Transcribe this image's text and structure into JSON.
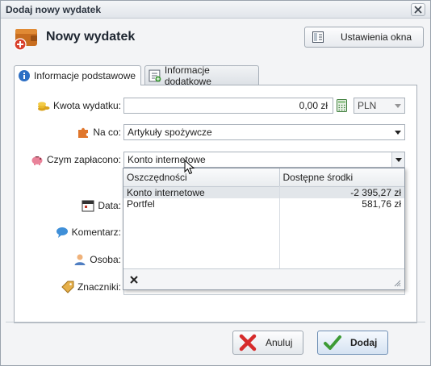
{
  "window": {
    "title": "Dodaj nowy wydatek"
  },
  "header": {
    "title": "Nowy wydatek",
    "settings_label": "Ustawienia okna"
  },
  "tabs": [
    {
      "label": "Informacje podstawowe",
      "active": true
    },
    {
      "label": "Informacje dodatkowe",
      "active": false
    }
  ],
  "form": {
    "amount_label": "Kwota wydatku:",
    "amount_value": "0,00 zł",
    "currency": "PLN",
    "category_label": "Na co:",
    "category_value": "Artykuły spożywcze",
    "payment_label": "Czym zapłacono:",
    "payment_value": "Konto internetowe",
    "date_label": "Data:",
    "comment_label": "Komentarz:",
    "person_label": "Osoba:",
    "tags_label": "Znaczniki:"
  },
  "accounts_popup": {
    "columns": [
      "Oszczędności",
      "Dostępne środki"
    ],
    "rows": [
      {
        "name": "Konto internetowe",
        "balance": "-2 395,27 zł",
        "selected": true
      },
      {
        "name": "Portfel",
        "balance": "581,76 zł",
        "selected": false
      }
    ]
  },
  "buttons": {
    "cancel": "Anuluj",
    "add": "Dodaj"
  },
  "colors": {
    "accent": "#d9402c",
    "wallet": "#c86d1f",
    "confirm": "#3d9b35"
  }
}
